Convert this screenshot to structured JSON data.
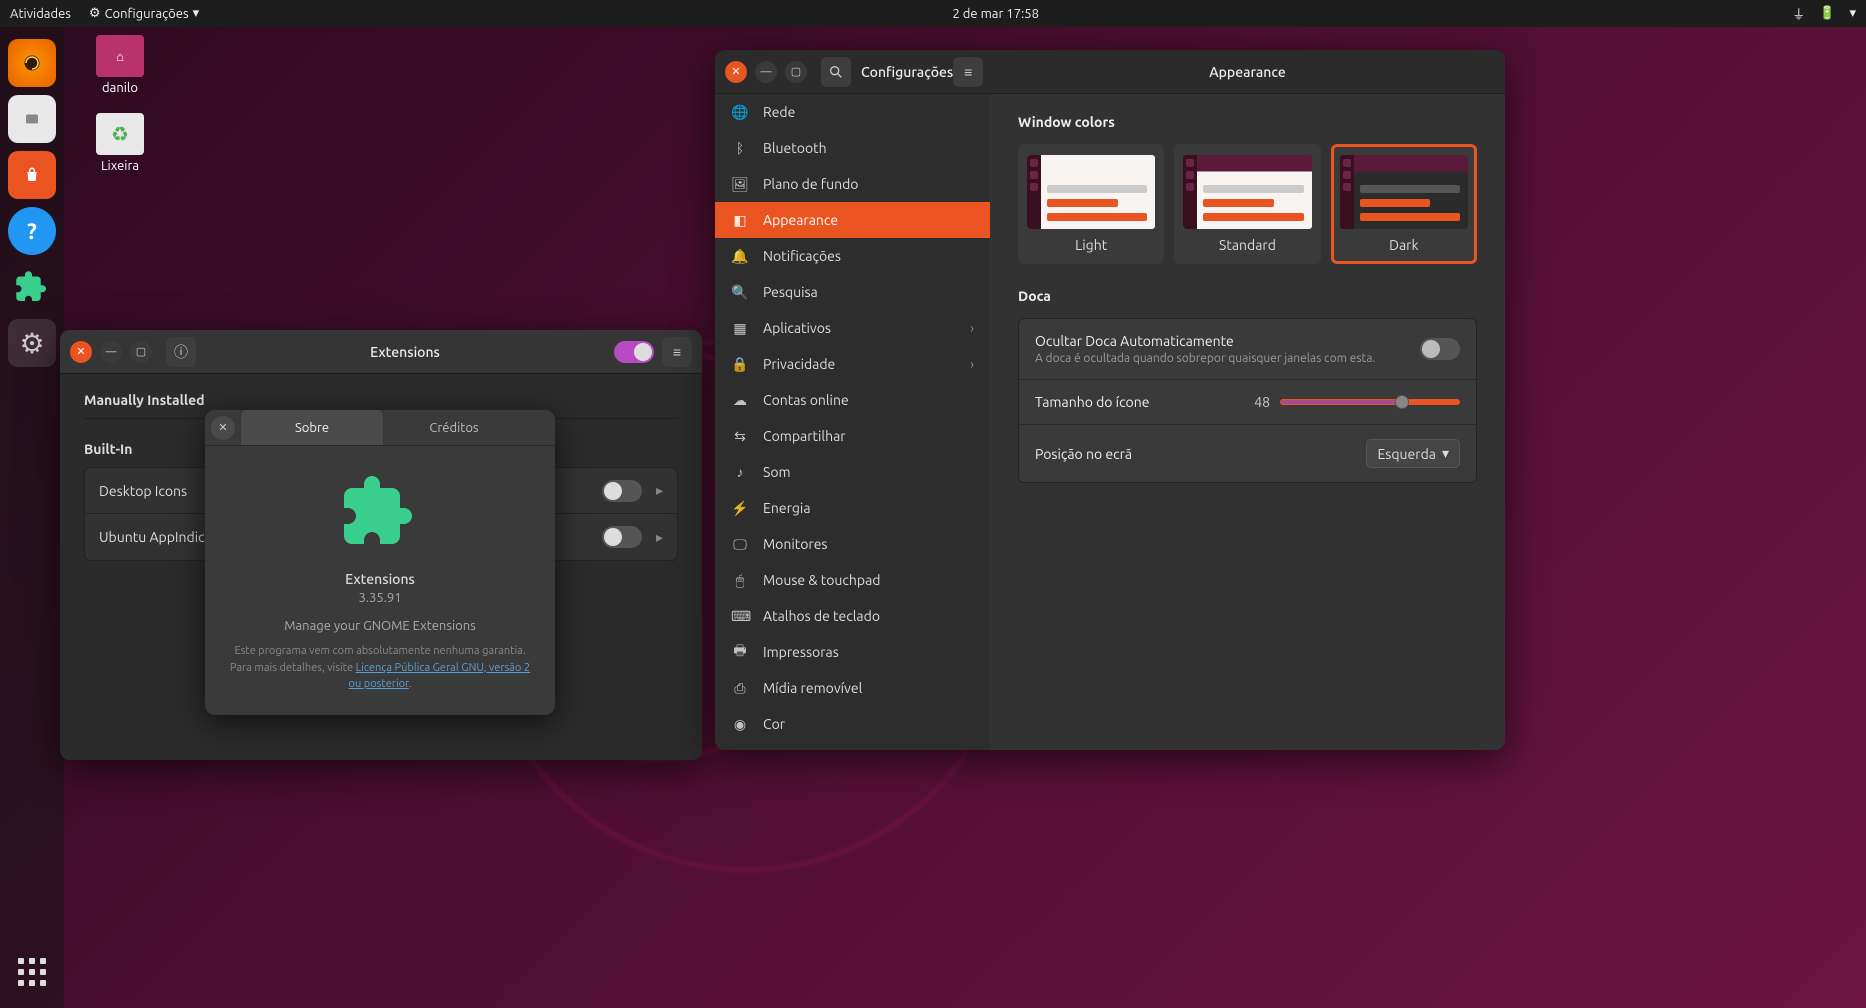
{
  "topbar": {
    "activities": "Atividades",
    "app_menu": "Configurações",
    "clock": "2 de mar  17:58"
  },
  "desktop": {
    "home_label": "danilo",
    "trash_label": "Lixeira"
  },
  "extensions_window": {
    "title": "Extensions",
    "manually_installed": "Manually Installed",
    "built_in": "Built-In",
    "rows": [
      {
        "name": "Desktop Icons"
      },
      {
        "name": "Ubuntu AppIndicators"
      }
    ]
  },
  "about_dialog": {
    "tab_about": "Sobre",
    "tab_credits": "Créditos",
    "app_name": "Extensions",
    "version": "3.35.91",
    "description": "Manage your GNOME Extensions",
    "warranty_line": "Este programa vem com absolutamente nenhuma garantia.",
    "details_prefix": "Para mais detalhes, visite ",
    "license_link": "Licença Pública Geral GNU, versão 2 ou posterior"
  },
  "settings_window": {
    "left_title": "Configurações",
    "right_title": "Appearance",
    "nav": {
      "rede": "Rede",
      "bluetooth": "Bluetooth",
      "plano": "Plano de fundo",
      "appearance": "Appearance",
      "notificacoes": "Notificações",
      "pesquisa": "Pesquisa",
      "aplicativos": "Aplicativos",
      "privacidade": "Privacidade",
      "contas": "Contas online",
      "compartilhar": "Compartilhar",
      "som": "Som",
      "energia": "Energia",
      "monitores": "Monitores",
      "mouse": "Mouse & touchpad",
      "atalhos": "Atalhos de teclado",
      "impressoras": "Impressoras",
      "midia": "Mídia removível",
      "cor": "Cor"
    },
    "appearance": {
      "window_colors": "Window colors",
      "light": "Light",
      "standard": "Standard",
      "dark": "Dark",
      "doca": "Doca",
      "autohide_title": "Ocultar Doca Automaticamente",
      "autohide_sub": "A doca é ocultada quando sobrepor quaisquer janelas com esta.",
      "icon_size": "Tamanho do ícone",
      "icon_size_value": "48",
      "position": "Posição no ecrã",
      "position_value": "Esquerda"
    }
  }
}
